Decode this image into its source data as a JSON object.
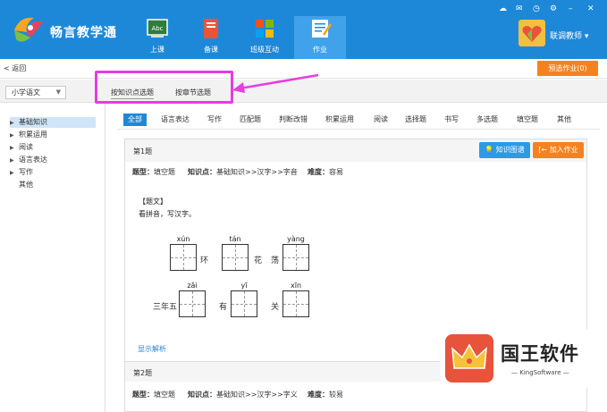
{
  "app": {
    "brand": "畅言教学通",
    "nav": [
      {
        "label": "上课",
        "icon": "blackboard-icon"
      },
      {
        "label": "备课",
        "icon": "book-icon"
      },
      {
        "label": "班级互动",
        "icon": "windows-grid-icon"
      },
      {
        "label": "作业",
        "icon": "homework-icon",
        "active": true
      }
    ],
    "user": {
      "name": "联调教师"
    },
    "window_icons": [
      "cloud-icon",
      "mail-icon",
      "clock-icon",
      "settings-icon",
      "minimize-icon",
      "close-icon"
    ]
  },
  "toolbar": {
    "back_label": "返回",
    "preview_label": "预选作业(0)"
  },
  "tabs": {
    "subject": "小学语文",
    "items": [
      {
        "label": "按知识点选题",
        "active": true
      },
      {
        "label": "按章节选题",
        "active": false
      }
    ]
  },
  "sidebar": {
    "items": [
      {
        "label": "基础知识",
        "expandable": true,
        "active": true
      },
      {
        "label": "积累运用",
        "expandable": true
      },
      {
        "label": "阅读",
        "expandable": true
      },
      {
        "label": "语言表达",
        "expandable": true
      },
      {
        "label": "写作",
        "expandable": true
      },
      {
        "label": "其他",
        "expandable": false
      }
    ]
  },
  "filters": [
    "全部",
    "语言表达",
    "写作",
    "匹配题",
    "判断改错",
    "积累运用",
    "阅读",
    "选择题",
    "书写",
    "多选题",
    "填空题",
    "其他"
  ],
  "question1": {
    "number": "第1题",
    "knowledge_btn": "知识图谱",
    "add_btn": "加入作业",
    "type_label": "题型：",
    "type_value": "填空题",
    "kp_label": "知识点：",
    "kp_value": "基础知识>>汉字>>字音",
    "diff_label": "难度：",
    "diff_value": "容易",
    "stem_tag": "【题文】",
    "stem": "看拼音，写汉字。",
    "row1": {
      "pinyin": [
        "xún",
        "tán",
        "yàng"
      ],
      "chars": [
        "环",
        "花",
        "荡"
      ]
    },
    "row2": {
      "prefix": "三年五",
      "pinyin": [
        "zǎi",
        "yī",
        "xīn"
      ],
      "chars": [
        "有",
        "关"
      ]
    },
    "show_answer": "显示解析"
  },
  "question2": {
    "number": "第2题",
    "type_label": "题型：",
    "type_value": "填空题",
    "kp_label": "知识点：",
    "kp_value": "基础知识>>汉字>>字义",
    "diff_label": "难度：",
    "diff_value": "较易"
  },
  "watermark": {
    "title": "国王软件",
    "subtitle": "KingSoftware"
  },
  "colors": {
    "header": "#1e88d8",
    "accent_orange": "#f58220",
    "active_blue": "#1e88d8",
    "highlight": "#e83ce0"
  }
}
